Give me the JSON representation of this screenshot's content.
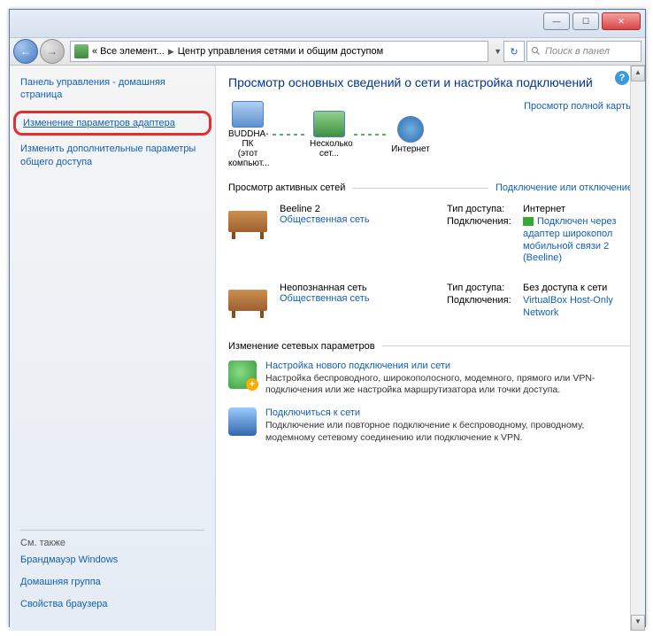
{
  "titlebar": {
    "min": "—",
    "max": "☐",
    "close": "✕"
  },
  "nav": {
    "crumb1": "« Все элемент...",
    "crumb2": "Центр управления сетями и общим доступом",
    "search_placeholder": "Поиск в панел"
  },
  "sidebar": {
    "home": "Панель управления - домашняя страница",
    "link_adapter": "Изменение параметров адаптера",
    "link_sharing": "Изменить дополнительные параметры общего доступа",
    "see_also": "См. также",
    "firewall": "Брандмауэр Windows",
    "homegroup": "Домашняя группа",
    "browser": "Свойства браузера"
  },
  "main": {
    "heading": "Просмотр основных сведений о сети и настройка подключений",
    "fullmap": "Просмотр полной карты",
    "map": {
      "node1": "BUDDHA-ПК",
      "node1_sub": "(этот компьют...",
      "node2": "Несколько сет...",
      "node3": "Интернет"
    },
    "active_nets": "Просмотр активных сетей",
    "connect_link": "Подключение или отключение",
    "type_label": "Тип доступа:",
    "conn_label": "Подключения:",
    "net1": {
      "name": "Beeline 2",
      "type": "Общественная сеть",
      "access": "Интернет",
      "conn": "Подключен через адаптер широкопол мобильной связи 2 (Beeline)"
    },
    "net2": {
      "name": "Неопознанная сеть",
      "type": "Общественная сеть",
      "access": "Без доступа к сети",
      "conn": "VirtualBox Host-Only Network"
    },
    "change": "Изменение сетевых параметров",
    "task1": {
      "t": "Настройка нового подключения или сети",
      "d": "Настройка беспроводного, широкополосного, модемного, прямого или VPN-подключения или же настройка маршрутизатора или точки доступа."
    },
    "task2": {
      "t": "Подключиться к сети",
      "d": "Подключение или повторное подключение к беспроводному, проводному, модемному сетевому соединению или подключение к VPN."
    }
  }
}
